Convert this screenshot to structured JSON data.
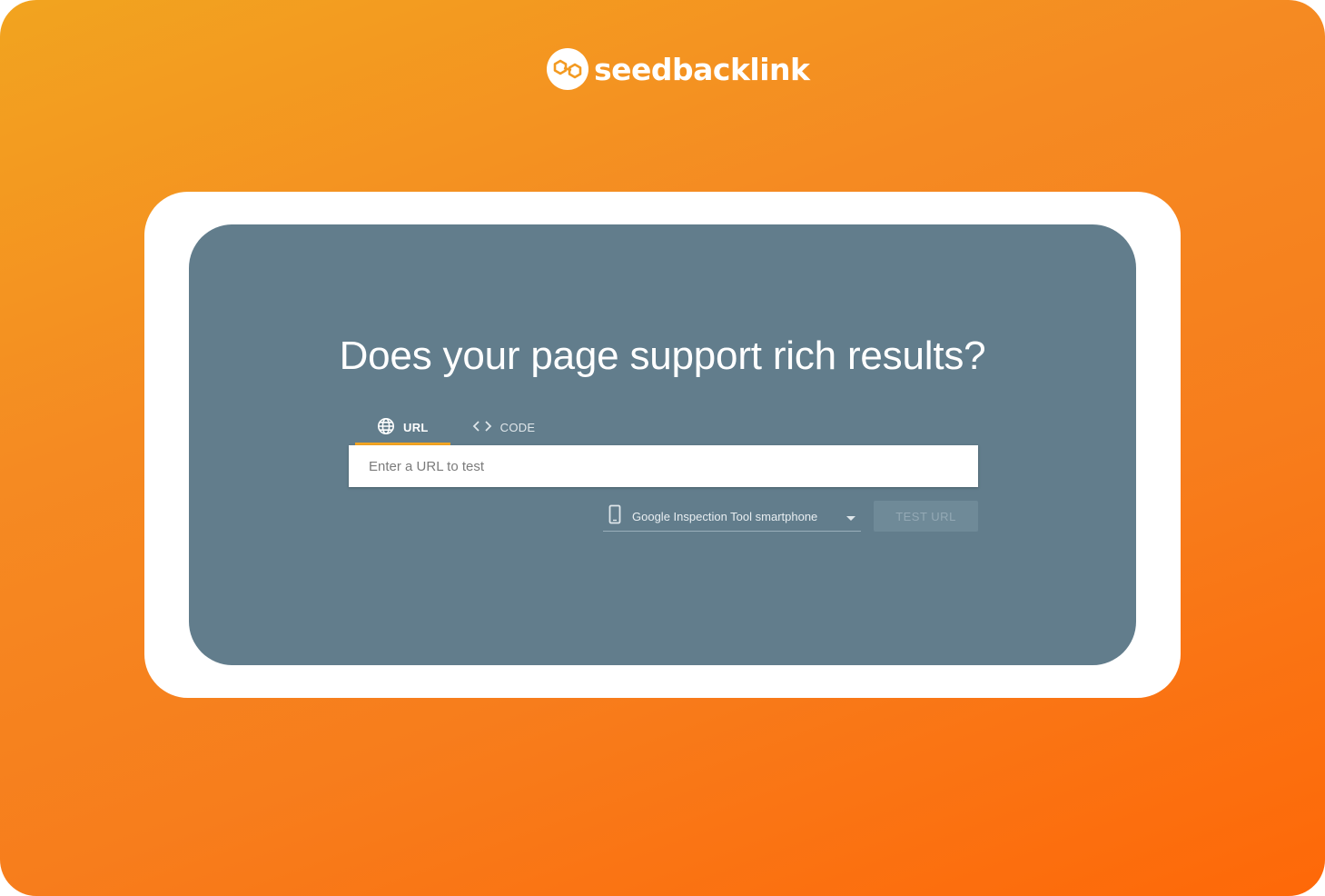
{
  "brand": {
    "name": "seedbacklink",
    "logo_icon": "seedbacklink-logo-icon"
  },
  "colors": {
    "gradient_start": "#f2a41f",
    "gradient_end": "#fe6808",
    "panel": "#627d8c",
    "tab_indicator": "#f5a623"
  },
  "main": {
    "title": "Does your page support rich results?",
    "tabs": [
      {
        "label": "URL",
        "icon": "globe-icon",
        "active": true
      },
      {
        "label": "CODE",
        "icon": "code-icon",
        "active": false
      }
    ],
    "url_input": {
      "placeholder": "Enter a URL to test",
      "value": ""
    },
    "device_select": {
      "icon": "smartphone-icon",
      "selected": "Google Inspection Tool smartphone"
    },
    "submit_label": "TEST URL"
  }
}
